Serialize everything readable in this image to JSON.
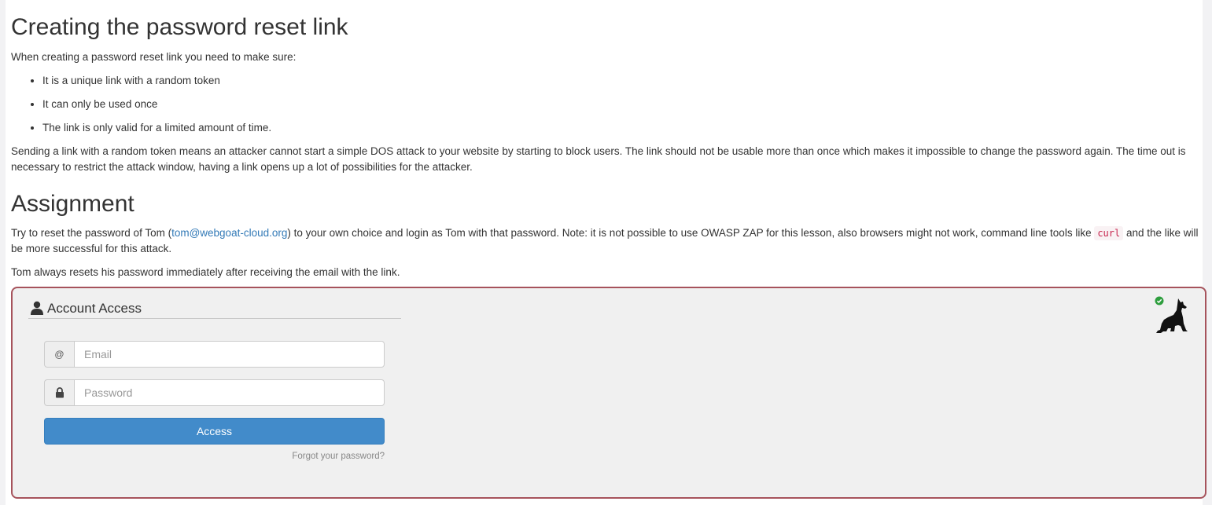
{
  "lesson": {
    "title": "Creating the password reset link",
    "intro": "When creating a password reset link you need to make sure:",
    "rules": [
      "It is a unique link with a random token",
      "It can only be used once",
      "The link is only valid for a limited amount of time."
    ],
    "explanation": "Sending a link with a random token means an attacker cannot start a simple DOS attack to your website by starting to block users. The link should not be usable more than once which makes it impossible to change the password again. The time out is necessary to restrict the attack window, having a link opens up a lot of possibilities for the attacker."
  },
  "assignment": {
    "heading": "Assignment",
    "text_before_link": "Try to reset the password of Tom (",
    "email_link": "tom@webgoat-cloud.org",
    "text_after_link": ") to your own choice and login as Tom with that password. Note: it is not possible to use OWASP ZAP for this lesson, also browsers might not work, command line tools like ",
    "code": "curl",
    "text_after_code": " and the like will be more successful for this attack.",
    "note": "Tom always resets his password immediately after receiving the email with the link."
  },
  "form": {
    "legend": "Account Access",
    "email_addon": "@",
    "email_placeholder": "Email",
    "password_placeholder": "Password",
    "access_button": "Access",
    "forgot_link": "Forgot your password?",
    "icons": {
      "legend": "user-icon",
      "email": "at-sign-icon",
      "password": "lock-icon",
      "status": "check-circle-icon",
      "mascot": "wolf-icon"
    },
    "status_color": "#2e9e3e",
    "border_color": "#a6535c",
    "button_color": "#428bca"
  }
}
